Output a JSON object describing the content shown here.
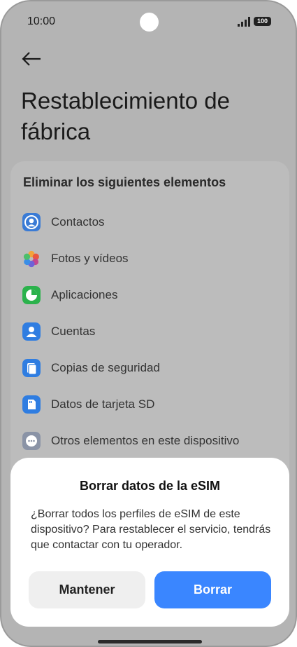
{
  "status": {
    "time": "10:00",
    "battery": "100"
  },
  "page": {
    "title": "Restablecimiento de fábrica"
  },
  "card": {
    "title": "Eliminar los siguientes elementos",
    "items": [
      {
        "label": "Contactos",
        "icon": "contacts-icon",
        "color": "#3a7bd5"
      },
      {
        "label": "Fotos y vídeos",
        "icon": "photos-icon",
        "color": "#e0745a"
      },
      {
        "label": "Aplicaciones",
        "icon": "apps-icon",
        "color": "#2bb24c"
      },
      {
        "label": "Cuentas",
        "icon": "accounts-icon",
        "color": "#2f7de1"
      },
      {
        "label": "Copias de seguridad",
        "icon": "backup-icon",
        "color": "#2f7de1"
      },
      {
        "label": "Datos de tarjeta SD",
        "icon": "sd-card-icon",
        "color": "#2f7de1"
      },
      {
        "label": "Otros elementos en este dispositivo",
        "icon": "more-icon",
        "color": "#8a93a6"
      }
    ]
  },
  "dialog": {
    "title": "Borrar datos de la eSIM",
    "message": "¿Borrar todos los perfiles de eSIM de este dispositivo? Para restablecer el servicio, tendrás que contactar con tu operador.",
    "keep_label": "Mantener",
    "delete_label": "Borrar",
    "accent": "#3a86ff"
  }
}
